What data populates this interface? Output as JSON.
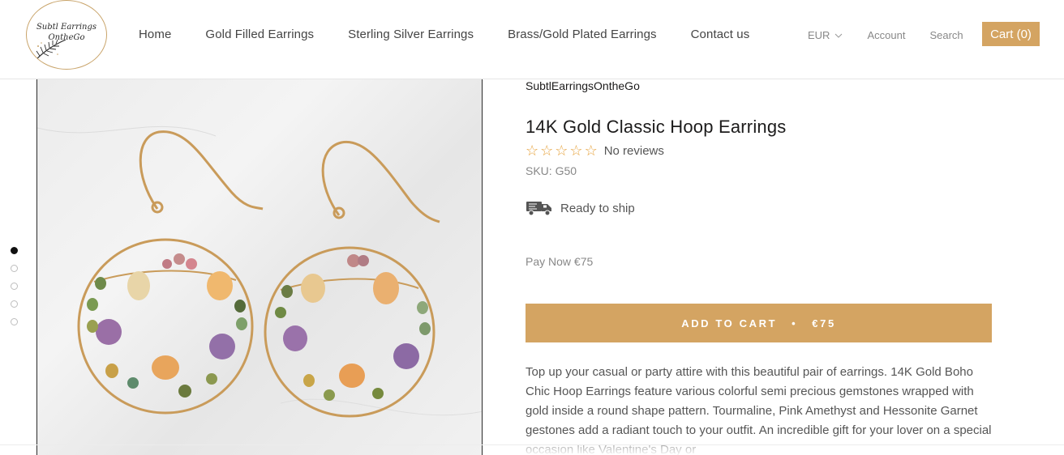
{
  "header": {
    "logo_text": [
      "Subtl Earrings",
      "OntheGo"
    ],
    "nav": [
      {
        "label": "Home"
      },
      {
        "label": "Gold Filled Earrings"
      },
      {
        "label": "Sterling Silver Earrings"
      },
      {
        "label": "Brass/Gold Plated Earrings"
      },
      {
        "label": "Contact us"
      }
    ],
    "currency": "EUR",
    "account": "Account",
    "search": "Search",
    "cart": "Cart (0)"
  },
  "gallery": {
    "slide_count": 5,
    "active_slide": 1
  },
  "product": {
    "vendor": "SubtlEarringsOntheGo",
    "title": "14K Gold Classic Hoop Earrings",
    "rating_stars": 5,
    "rating_filled": 0,
    "reviews_text": "No reviews",
    "sku": "SKU: G50",
    "ship_text": "Ready to ship",
    "pay_now": "Pay Now €75",
    "add_to_cart": {
      "label": "ADD TO CART",
      "separator": "•",
      "price": "€75"
    },
    "description": "Top up your casual or party attire with this beautiful pair of earrings. 14K Gold Boho Chic Hoop Earrings feature various colorful semi precious gemstones wrapped with gold inside a round shape pattern. Tourmaline, Pink Amethyst and Hessonite Garnet gestones add a radiant touch to your outfit. An incredible gift for your lover on a special occasion like Valentine's Day or"
  },
  "colors": {
    "accent": "#d4a462",
    "star": "#e6a23c",
    "text": "#1c1b1b",
    "muted": "#888888"
  }
}
